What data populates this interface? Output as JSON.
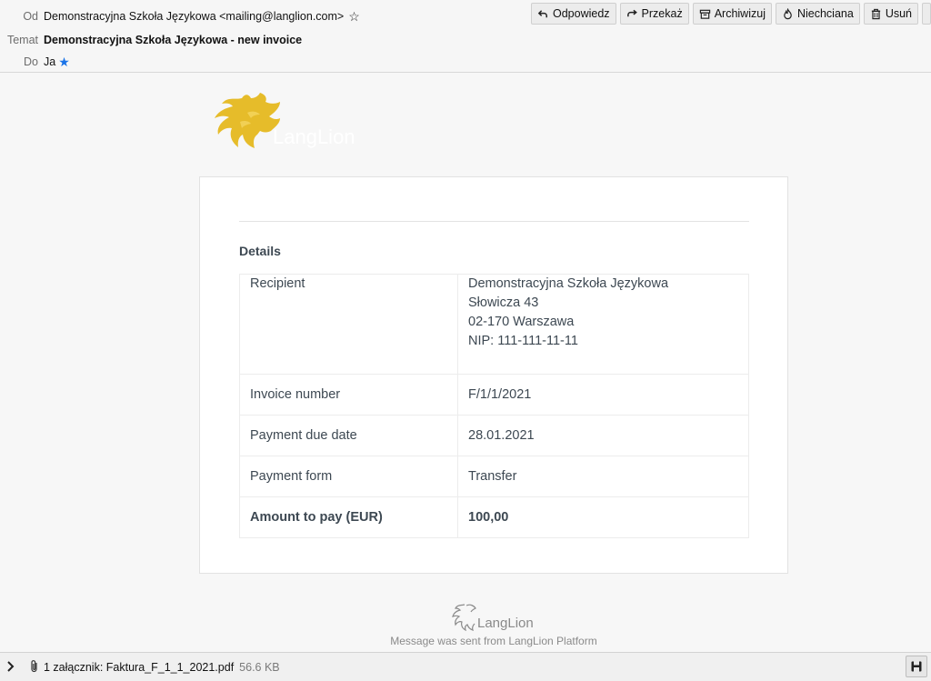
{
  "header": {
    "from_label": "Od",
    "from_value": "Demonstracyjna Szkoła Językowa <mailing@langlion.com>",
    "subject_label": "Temat",
    "subject_value": "Demonstracyjna Szkoła Językowa - new invoice",
    "to_label": "Do",
    "to_value": "Ja"
  },
  "toolbar": {
    "reply": "Odpowiedz",
    "forward": "Przekaż",
    "archive": "Archiwizuj",
    "junk": "Niechciana",
    "delete": "Usuń"
  },
  "email": {
    "details_title": "Details",
    "rows": [
      {
        "label": "Recipient",
        "lines": [
          "Demonstracyjna Szkoła Językowa",
          "Słowicza 43",
          "02-170 Warszawa",
          "NIP: 111-111-11-11"
        ]
      },
      {
        "label": "Invoice number",
        "value": "F/1/1/2021"
      },
      {
        "label": "Payment due date",
        "value": "28.01.2021"
      },
      {
        "label": "Payment form",
        "value": "Transfer"
      },
      {
        "label": "Amount to pay (EUR)",
        "value": "100,00"
      }
    ],
    "logo_text": "LangLion",
    "footer_logo_text": "LangLion",
    "footer_text": "Message was sent from LangLion Platform"
  },
  "attachment": {
    "summary": "1 załącznik: Faktura_F_1_1_2021.pdf",
    "size": "56.6 KB"
  },
  "colors": {
    "brand_gold": "#e5b81f",
    "star_blue": "#1a73e8"
  }
}
